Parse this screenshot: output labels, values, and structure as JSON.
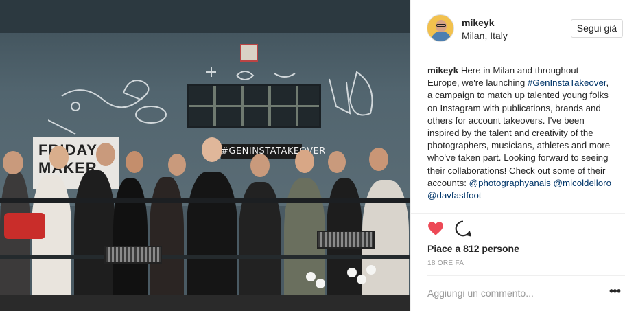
{
  "photo": {
    "banner_text": "FRIDAY\nMAKER",
    "sign_text": "#GENINSTATAKEOVER"
  },
  "post": {
    "username": "mikeyk",
    "location": "Milan, Italy",
    "follow_label": "Segui già",
    "caption": {
      "user": "mikeyk",
      "text_1": "Here in Milan and throughout Europe, we're launching ",
      "hashtag": "#GenInstaTakeover",
      "text_2": ", a campaign to match up talented young folks on Instagram with publications, brands and others for account takeovers. I've been inspired by the talent and creativity of the photographers, musicians, athletes and more who've taken part. Looking forward to seeing their collaborations! Check out some of their accounts: ",
      "mention_1": "@photographyanais",
      "mention_2": "@micoldelloro",
      "mention_3": "@davfastfoot"
    },
    "likes": "Piace a 812 persone",
    "time": "18 ORE FA",
    "comment_placeholder": "Aggiungi un commento...",
    "more_label": "•••"
  },
  "colors": {
    "heart": "#ed4956",
    "link": "#003569"
  }
}
